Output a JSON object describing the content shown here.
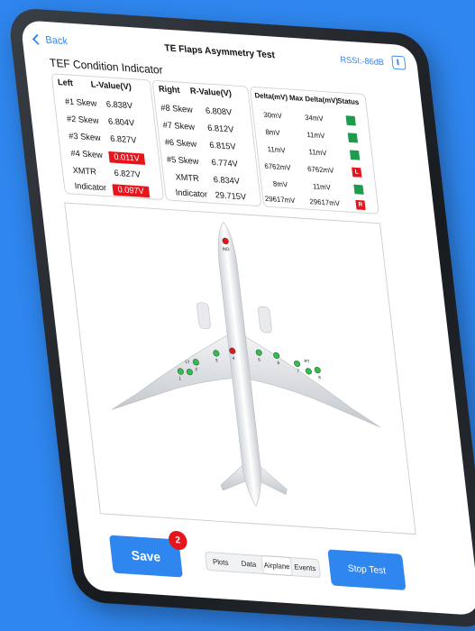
{
  "nav": {
    "back_label": "Back",
    "title": "TE Flaps Asymmetry Test",
    "rssi": "RSSI:-86dB"
  },
  "section_title": "TEF Condition Indicator",
  "left_panel": {
    "headers": [
      "Left",
      "L-Value(V)"
    ],
    "rows": [
      {
        "name": "#1 Skew",
        "value": "6.838V"
      },
      {
        "name": "#2 Skew",
        "value": "6.804V"
      },
      {
        "name": "#3 Skew",
        "value": "6.827V"
      },
      {
        "name": "#4 Skew",
        "value": "0.011V"
      },
      {
        "name": "XMTR",
        "value": "6.827V"
      },
      {
        "name": "Indicator",
        "value": "0.097V"
      }
    ]
  },
  "right_panel": {
    "headers": [
      "Right",
      "R-Value(V)"
    ],
    "rows": [
      {
        "name": "#8 Skew",
        "value": "6.808V"
      },
      {
        "name": "#7 Skew",
        "value": "6.812V"
      },
      {
        "name": "#6 Skew",
        "value": "6.815V"
      },
      {
        "name": "#5 Skew",
        "value": "6.774V"
      },
      {
        "name": "XMTR",
        "value": "6.834V"
      },
      {
        "name": "Indicator",
        "value": "29.715V"
      }
    ]
  },
  "delta_panel": {
    "headers": [
      "Delta(mV)",
      "Max Delta(mV)",
      "Status"
    ],
    "rows": [
      {
        "delta": "30mV",
        "max": "34mV",
        "status": ""
      },
      {
        "delta": "8mV",
        "max": "11mV",
        "status": ""
      },
      {
        "delta": "11mV",
        "max": "11mV",
        "status": ""
      },
      {
        "delta": "6762mV",
        "max": "6762mV",
        "status": "L"
      },
      {
        "delta": "8mV",
        "max": "11mV",
        "status": ""
      },
      {
        "delta": "29617mV",
        "max": "29617mV",
        "status": "R"
      }
    ]
  },
  "airplane_labels": {
    "ind": "IND",
    "lt": "LT",
    "rt": "RT",
    "s1": "1",
    "s2": "2",
    "s3": "3",
    "s4": "4",
    "s5": "5",
    "s6": "6",
    "s7": "7",
    "s8": "8"
  },
  "bottom": {
    "save_label": "Save",
    "badge_count": "2",
    "segments": [
      "Plots",
      "Data",
      "Airplane",
      "Events"
    ],
    "stop_label": "Stop Test"
  },
  "colors": {
    "accent": "#2f86ee",
    "ok": "#1f9b4f",
    "fault": "#e8141b"
  }
}
